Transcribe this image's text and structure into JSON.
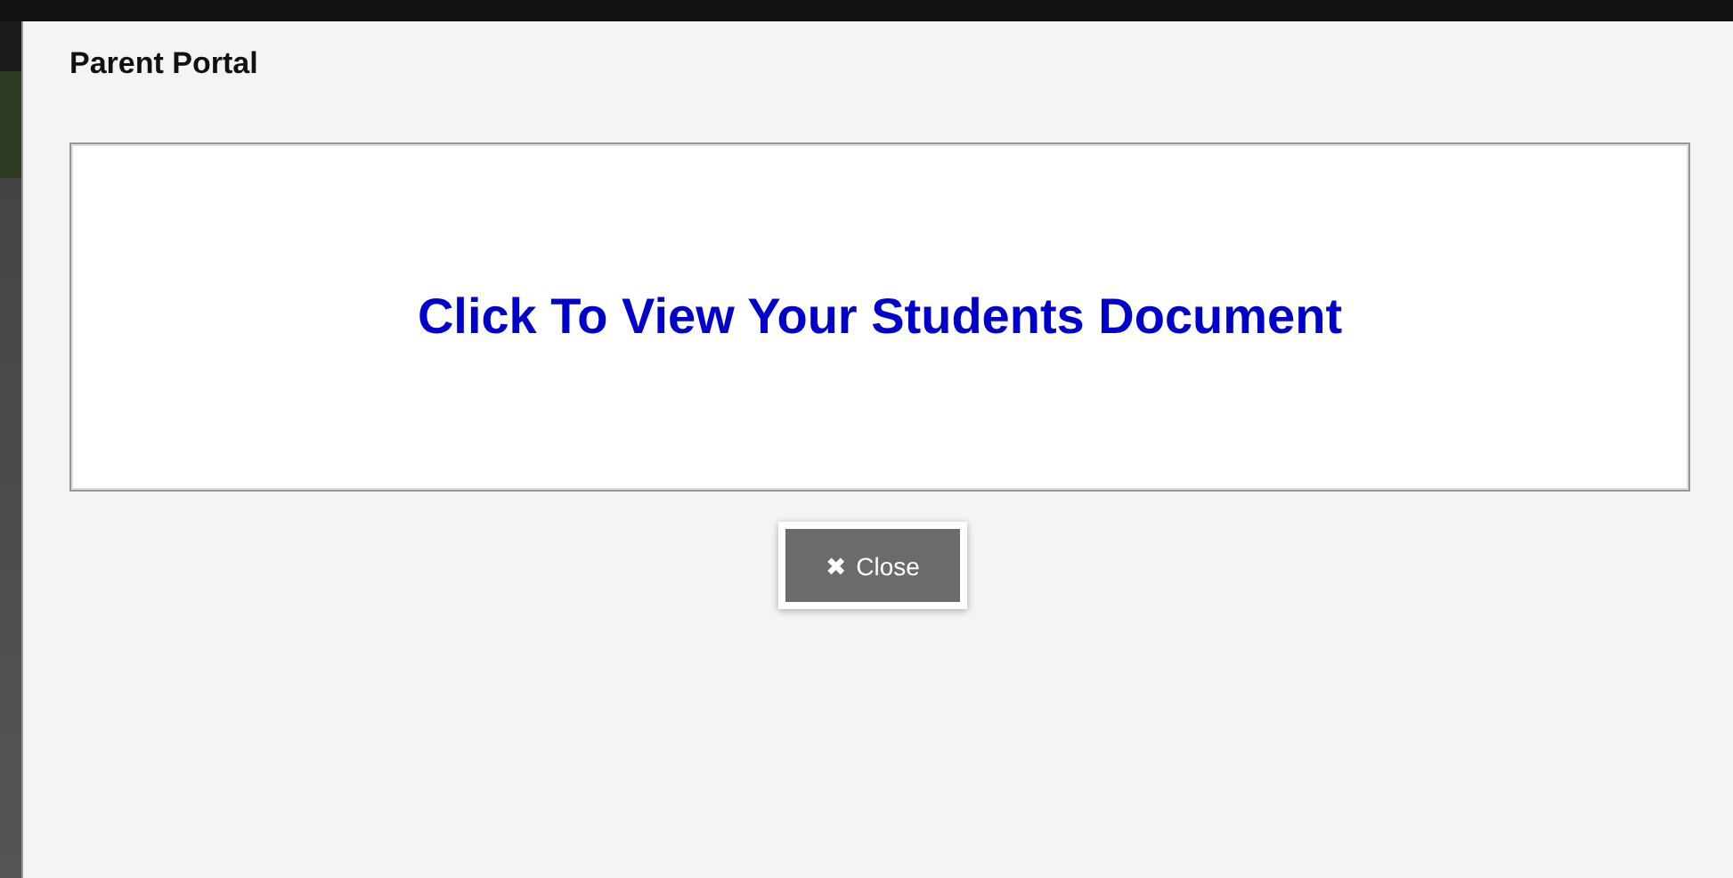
{
  "dialog": {
    "title": "Parent Portal",
    "link": "Click To View Your Students Document",
    "close_button": {
      "icon": "✖",
      "label": "Close"
    }
  }
}
